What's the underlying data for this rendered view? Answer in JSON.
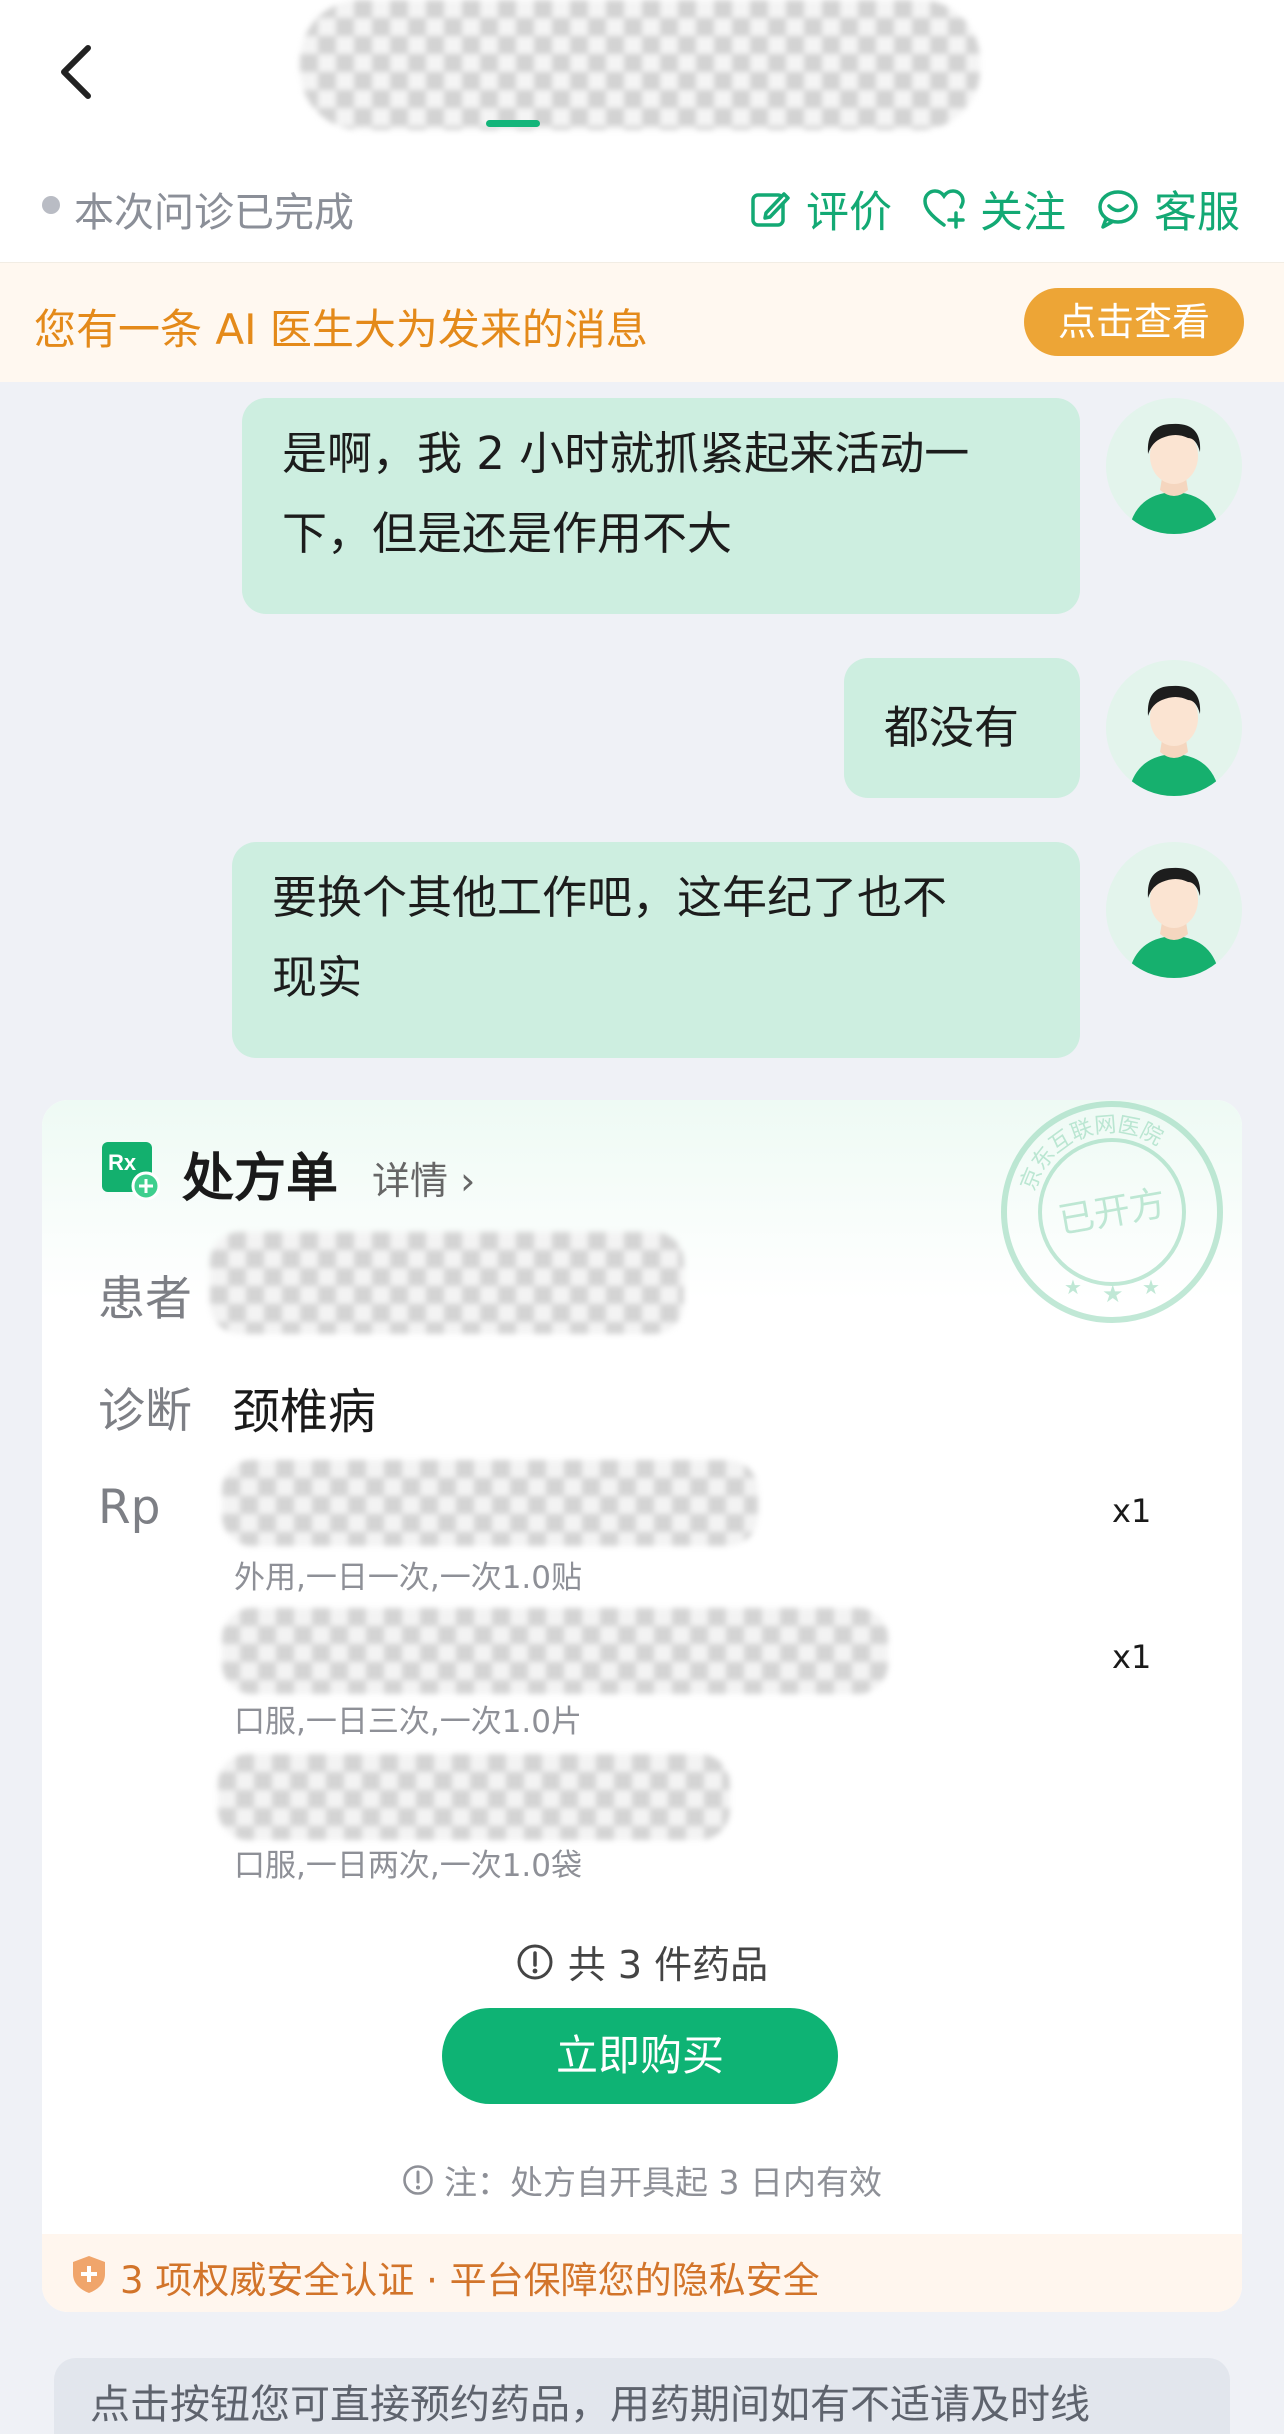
{
  "header": {
    "status_text": "本次问诊已完成",
    "actions": [
      {
        "label": "评价",
        "icon": "edit-icon"
      },
      {
        "label": "关注",
        "icon": "heart-plus-icon"
      },
      {
        "label": "客服",
        "icon": "smile-chat-icon"
      }
    ]
  },
  "ai_banner": {
    "text": "您有一条 AI 医生大为发来的消息",
    "button": "点击查看"
  },
  "messages": [
    {
      "text_line1": "是啊，我 2 小时就抓紧起来活动一",
      "text_line2": "下，但是还是作用不大"
    },
    {
      "text_line1": "都没有"
    },
    {
      "text_line1": "要换个其他工作吧，这年纪了也不",
      "text_line2": "现实"
    }
  ],
  "prescription": {
    "title": "处方单",
    "detail_link": "详情 ›",
    "stamp_text": "已开方",
    "stamp_ring_text": "京东互联网医院",
    "patient_label": "患者",
    "diagnosis_label": "诊断",
    "diagnosis_value": "颈椎病",
    "rp_label": "Rp",
    "drugs": [
      {
        "usage": "外用,一日一次,一次1.0贴",
        "qty": "x1"
      },
      {
        "usage": "口服,一日三次,一次1.0片",
        "qty": "x1"
      },
      {
        "usage": "口服,一日两次,一次1.0袋",
        "qty": ""
      }
    ],
    "count_text": "共 3 件药品",
    "buy_button": "立即购买",
    "note_text": "注：处方自开具起 3 日内有效",
    "security_text": "3 项权威安全认证 · 平台保障您的隐私安全"
  },
  "bottom_tip": "点击按钮您可直接预约药品，用药期间如有不适请及时线",
  "colors": {
    "accent_green": "#13a974",
    "bubble_green": "#cdeee0",
    "banner_orange": "#eda536",
    "background": "#eff1f6"
  }
}
